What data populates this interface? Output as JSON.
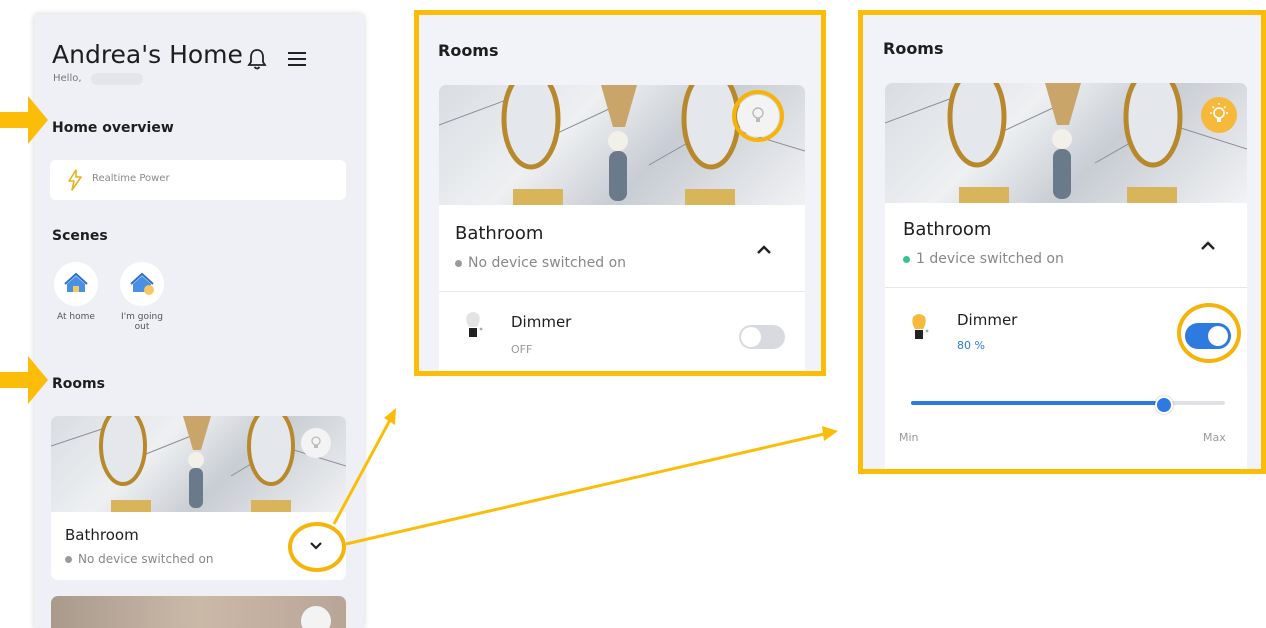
{
  "phone": {
    "home_title": "Andrea's Home",
    "greeting": "Hello,",
    "home_overview_title": "Home overview",
    "realtime_power_label": "Realtime Power",
    "scenes_title": "Scenes",
    "scenes": [
      {
        "label": "At home",
        "icon": "house-icon"
      },
      {
        "label": "I'm going out",
        "icon": "house-leave-icon"
      }
    ],
    "rooms_title": "Rooms",
    "room": {
      "name": "Bathroom",
      "status": "No device switched on"
    }
  },
  "panel_off": {
    "title": "Rooms",
    "room_name": "Bathroom",
    "room_status": "No device switched on",
    "device_name": "Dimmer",
    "device_state": "OFF",
    "toggle_on": false
  },
  "panel_on": {
    "title": "Rooms",
    "room_name": "Bathroom",
    "room_status": "1 device switched on",
    "device_name": "Dimmer",
    "device_state": "80 %",
    "toggle_on": true,
    "slider_value": 80,
    "slider_min_label": "Min",
    "slider_max_label": "Max"
  },
  "colors": {
    "highlight": "#fbbd08",
    "accent_blue": "#2d7ae0",
    "status_on": "#35c48d",
    "status_off": "#9a9a9a",
    "lamp_on": "#f6b93b"
  }
}
